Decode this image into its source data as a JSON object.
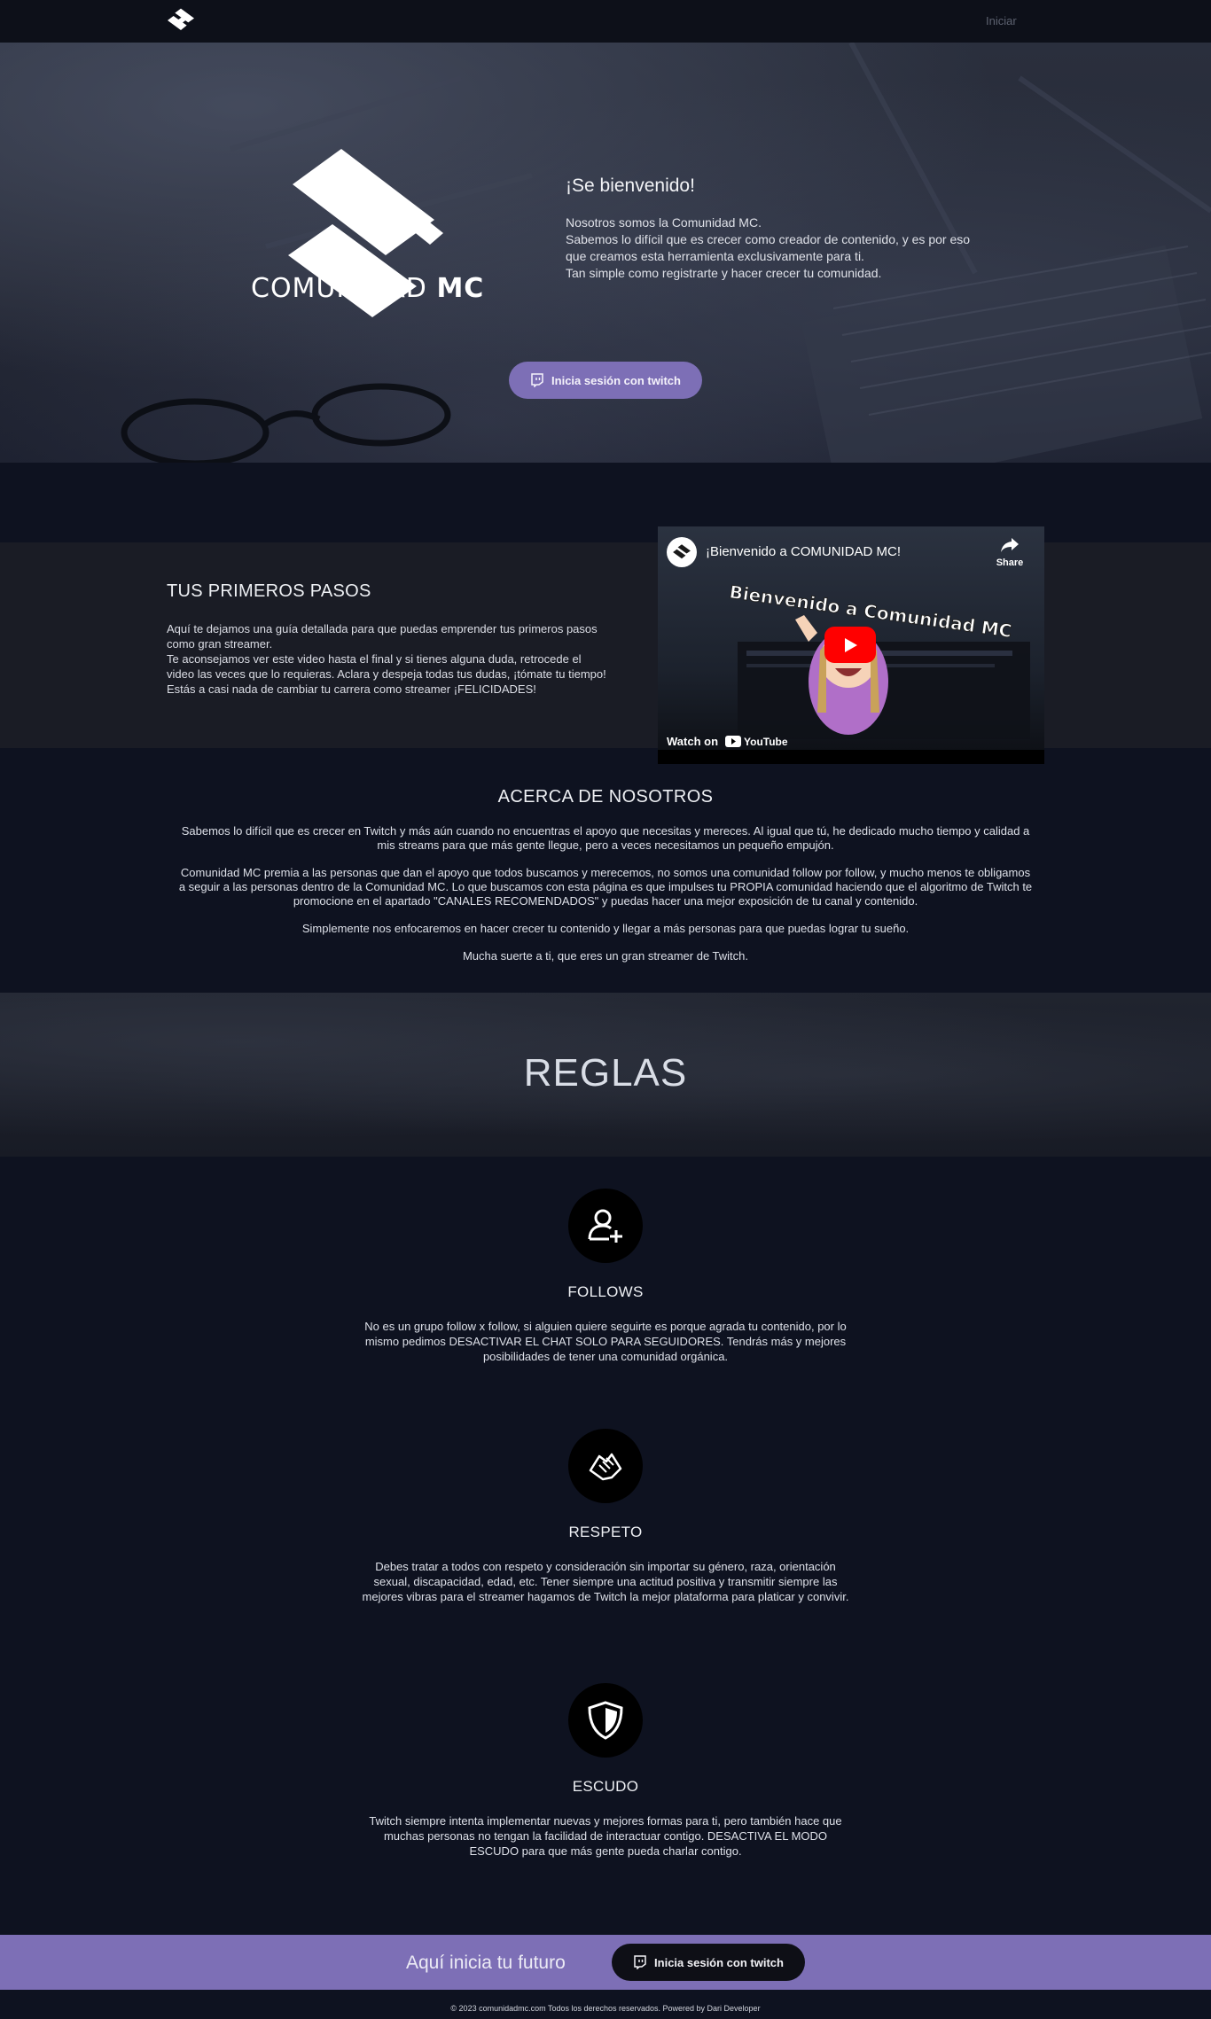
{
  "nav": {
    "login_label": "Iniciar"
  },
  "hero": {
    "brand_light": "COMUNIDAD ",
    "brand_bold": "MC",
    "welcome_title": "¡Se bienvenido!",
    "welcome_lines": [
      "Nosotros somos la Comunidad MC.",
      "Sabemos lo difícil que es crecer como creador de contenido, y es por eso que creamos esta herramienta exclusivamente para ti.",
      "Tan simple como registrarte y hacer crecer tu comunidad."
    ],
    "cta_label": "Inicia sesión con twitch"
  },
  "steps": {
    "title": "TUS PRIMEROS PASOS",
    "lines": [
      "Aquí te dejamos una guía detallada para que puedas emprender tus primeros pasos como gran streamer.",
      "Te aconsejamos ver este video hasta el final y si tienes alguna duda, retrocede el video las veces que lo requieras. Aclara y despeja todas tus dudas, ¡tómate tu tiempo!",
      "Estás a casi nada de cambiar tu carrera como streamer ¡FELICIDADES!"
    ],
    "video": {
      "title": "¡Bienvenido a COMUNIDAD MC!",
      "thumbnail_text": "Bienvenido a Comunidad MC",
      "share_label": "Share",
      "watch_on": "Watch on",
      "youtube_label": "YouTube"
    }
  },
  "about": {
    "title": "ACERCA DE NOSOTROS",
    "paragraphs": [
      "Sabemos lo difícil que es crecer en Twitch y más aún cuando no encuentras el apoyo que necesitas y mereces. Al igual que tú, he dedicado mucho tiempo y calidad a mis streams para que más gente llegue, pero a veces necesitamos un pequeño empujón.",
      "Comunidad MC premia a las personas que dan el apoyo que todos buscamos y merecemos, no somos una comunidad follow por follow, y mucho menos te obligamos a seguir a las personas dentro de la Comunidad MC. Lo que buscamos con esta página es que impulses tu PROPIA comunidad haciendo que el algoritmo de Twitch te promocione en el apartado \"CANALES RECOMENDADOS\" y puedas hacer una mejor exposición de tu canal y contenido.",
      "Simplemente nos enfocaremos en hacer crecer tu contenido y llegar a más personas para que puedas lograr tu sueño.",
      "Mucha suerte a ti, que eres un gran streamer de Twitch."
    ]
  },
  "rules": {
    "title": "REGLAS",
    "items": [
      {
        "icon": "user-plus-icon",
        "title": "FOLLOWS",
        "body": "No es un grupo follow x follow, si alguien quiere seguirte es porque agrada tu contenido, por lo mismo pedimos DESACTIVAR EL CHAT SOLO PARA SEGUIDORES. Tendrás más y mejores posibilidades de tener una comunidad orgánica."
      },
      {
        "icon": "handshake-icon",
        "title": "RESPETO",
        "body": "Debes tratar a todos con respeto y consideración sin importar su género, raza, orientación sexual, discapacidad, edad, etc. Tener siempre una actitud positiva y transmitir siempre las mejores vibras para el streamer hagamos de Twitch la mejor plataforma para platicar y convivir."
      },
      {
        "icon": "shield-icon",
        "title": "ESCUDO",
        "body": "Twitch siempre intenta implementar nuevas y mejores formas para ti, pero también hace que muchas personas no tengan la facilidad de interactuar contigo. DESACTIVA EL MODO ESCUDO para que más gente pueda charlar contigo."
      }
    ]
  },
  "footer": {
    "cta_text": "Aquí inicia tu futuro",
    "cta_label": "Inicia sesión con twitch",
    "copyright": "© 2023 comunidadmc.com Todos los derechos reservados. Powered by Dari Developer"
  },
  "colors": {
    "accent": "#7d6fb6",
    "background": "#0e1220",
    "youtube_red": "#ff0000"
  }
}
